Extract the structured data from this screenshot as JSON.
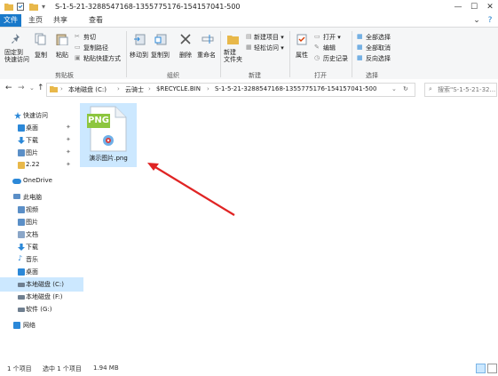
{
  "window": {
    "title": "S-1-5-21-3288547168-1355775176-154157041-500",
    "controls": {
      "minimize": "—",
      "maximize": "☐",
      "close": "✕"
    }
  },
  "tabs": [
    {
      "label": "文件",
      "active": true
    },
    {
      "label": "主页",
      "active": false
    },
    {
      "label": "共享",
      "active": false
    },
    {
      "label": "查看",
      "active": false
    }
  ],
  "ribbon": {
    "clipboard": {
      "pin_label": "固定到\n快速访问",
      "copy_label": "复制",
      "paste_label": "粘贴",
      "cut_label": "剪切",
      "copy_path_label": "复制路径",
      "paste_shortcut_label": "粘贴快捷方式",
      "group_label": "剪贴板"
    },
    "organize": {
      "move_to_label": "移动到",
      "copy_to_label": "复制到",
      "delete_label": "删除",
      "rename_label": "重命名",
      "group_label": "组织"
    },
    "new": {
      "new_folder_label": "新建\n文件夹",
      "new_item_label": "新建项目 ▾",
      "easy_access_label": "轻松访问 ▾",
      "group_label": "新建"
    },
    "open": {
      "properties_label": "属性",
      "open_label": "打开 ▾",
      "edit_label": "编辑",
      "history_label": "历史记录",
      "group_label": "打开"
    },
    "select": {
      "select_all_label": "全部选择",
      "select_none_label": "全部取消",
      "invert_label": "反向选择",
      "group_label": "选择"
    }
  },
  "address": {
    "crumbs": [
      "本地磁盘 (C:)",
      "云骑士",
      "$RECYCLE.BIN",
      "S-1-5-21-3288547168-1355775176-154157041-500"
    ],
    "separator": "›",
    "search_placeholder": "搜索\"S-1-5-21-32..."
  },
  "sidebar": {
    "items": [
      {
        "label": "快速访问",
        "icon": "star-icon",
        "color": "#2b88d8",
        "pinned": false
      },
      {
        "label": "桌面",
        "icon": "desktop-icon",
        "color": "#2b88d8",
        "pinned": true
      },
      {
        "label": "下载",
        "icon": "download-icon",
        "color": "#2b88d8",
        "pinned": true
      },
      {
        "label": "图片",
        "icon": "pictures-icon",
        "color": "#5b8fc7",
        "pinned": true
      },
      {
        "label": "2.22",
        "icon": "folder-icon",
        "color": "#e8b84a",
        "pinned": true
      },
      {
        "label": "OneDrive",
        "icon": "cloud-icon",
        "color": "#2b88d8",
        "pinned": false
      },
      {
        "label": "此电脑",
        "icon": "computer-icon",
        "color": "#5b8fc7",
        "pinned": false
      },
      {
        "label": "视频",
        "icon": "video-icon",
        "color": "#5b8fc7",
        "pinned": false
      },
      {
        "label": "图片",
        "icon": "pictures-icon",
        "color": "#5b8fc7",
        "pinned": false
      },
      {
        "label": "文档",
        "icon": "documents-icon",
        "color": "#8aa6c8",
        "pinned": false
      },
      {
        "label": "下载",
        "icon": "download-icon",
        "color": "#2b88d8",
        "pinned": false
      },
      {
        "label": "音乐",
        "icon": "music-icon",
        "color": "#2b88d8",
        "pinned": false
      },
      {
        "label": "桌面",
        "icon": "desktop-icon",
        "color": "#2b88d8",
        "pinned": false
      },
      {
        "label": "本地磁盘 (C:)",
        "icon": "drive-icon",
        "color": "#6f7f90",
        "pinned": false,
        "selected": true
      },
      {
        "label": "本地磁盘 (F:)",
        "icon": "drive-icon",
        "color": "#6f7f90",
        "pinned": false
      },
      {
        "label": "软件 (G:)",
        "icon": "drive-icon",
        "color": "#6f7f90",
        "pinned": false
      },
      {
        "label": "网络",
        "icon": "network-icon",
        "color": "#2b88d8",
        "pinned": false
      }
    ],
    "pin_glyph": "📌"
  },
  "file": {
    "name": "演示图片.png",
    "type_badge": "PNG",
    "badge_color": "#8dc63f"
  },
  "status": {
    "count": "1 个项目",
    "selected": "选中 1 个项目",
    "size": "1.94 MB"
  },
  "colors": {
    "accent": "#1979ca",
    "selection": "#cce8ff",
    "arrow": "#e02424"
  }
}
